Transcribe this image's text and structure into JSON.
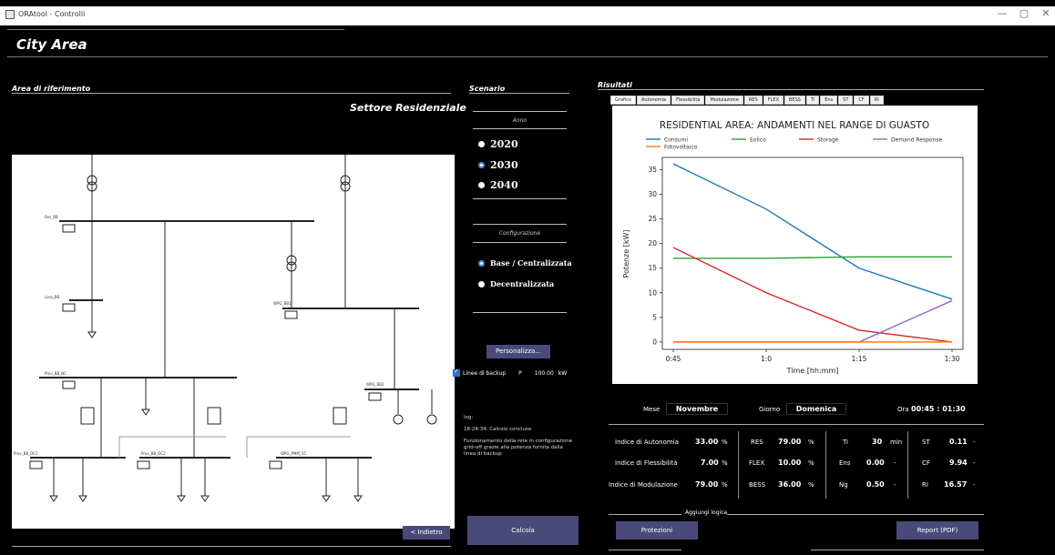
{
  "window": {
    "title": "ORAtool - Controlli",
    "minimize": "—",
    "maximize": "▢",
    "close": "✕"
  },
  "page": {
    "title": "City Area"
  },
  "left": {
    "section": "Area di riferimento",
    "sector": "Settore Residenziale",
    "back_label": "< Indietro"
  },
  "diagram": {
    "nodes": [
      "Res_BB",
      "Loss_BB",
      "WPG_BB1",
      "Prov_BB_NC",
      "WPG_BB2",
      "Prov_BB_DC1",
      "Prov_BB_DC2",
      "WPG_PMM_55"
    ]
  },
  "scenario": {
    "section": "Scenario",
    "anno_caption": "Anno",
    "years": [
      {
        "label": "2020",
        "checked": false
      },
      {
        "label": "2030",
        "checked": true
      },
      {
        "label": "2040",
        "checked": false
      }
    ],
    "config_caption": "Configurazione",
    "configs": [
      {
        "label": "Base / Centralizzata",
        "checked": true
      },
      {
        "label": "Decentralizzata",
        "checked": false
      }
    ],
    "personalizza": "Personalizza...",
    "backup": {
      "label": "Linee di backup",
      "p": "P",
      "value": "100.00",
      "unit": "kW",
      "checked": true
    },
    "log_label": "log:",
    "log_line1": "18:24:34: Calcolo concluso",
    "log_line2": "Funzionamento della rete in configurazione grid-off grazie alla potenza fornita dalla linea di backup",
    "calcola": "Calcola"
  },
  "results": {
    "section": "Risultati",
    "tabs": [
      "Grafico",
      "Autonomia",
      "Flessibilità",
      "Modulazione",
      "RES",
      "FLEX",
      "BESS",
      "Ti",
      "Ens",
      "ST",
      "CF",
      "RI"
    ],
    "active_tab": 0,
    "mese_label": "Mese",
    "mese": "Novembre",
    "giorno_label": "Giorno",
    "giorno": "Domenica",
    "ora_label": "Ora",
    "ora": "00:45 : 01:30",
    "indices": {
      "autonomia_label": "Indice di Autonomia",
      "autonomia": "33.00",
      "autonomia_unit": "%",
      "flessibilita_label": "Indice di Flessibilità",
      "flessibilita": "7.00",
      "flessibilita_unit": "%",
      "modulazione_label": "Indice di Modulazione",
      "modulazione": "79.00",
      "modulazione_unit": "%",
      "res_label": "RES",
      "res": "79.00",
      "res_unit": "%",
      "flex_label": "FLEX",
      "flex": "10.00",
      "flex_unit": "%",
      "bess_label": "BESS",
      "bess": "36.00",
      "bess_unit": "%",
      "ti_label": "Ti",
      "ti": "30",
      "ti_unit": "min",
      "ens_label": "Ens",
      "ens": "0.00",
      "ens_unit": "-",
      "ng_label": "Ng",
      "ng": "0.50",
      "ng_unit": "-",
      "st_label": "ST",
      "st": "0.11",
      "st_unit": "-",
      "cf_label": "CF",
      "cf": "9.94",
      "cf_unit": "-",
      "ri_label": "RI",
      "ri": "16.57",
      "ri_unit": "-"
    },
    "aggiungi_label": "Aggiungi logica",
    "protezioni": "Protezioni",
    "report": "Report (PDF)"
  },
  "chart_data": {
    "type": "line",
    "title": "RESIDENTIAL AREA: ANDAMENTI NEL RANGE DI GUASTO",
    "xlabel": "Time [hh:mm]",
    "ylabel": "Potenze [kW]",
    "categories": [
      "0:45",
      "1:0",
      "1:15",
      "1:30"
    ],
    "ylim": [
      -1.5,
      37.5
    ],
    "yticks": [
      0,
      5,
      10,
      15,
      20,
      25,
      30,
      35
    ],
    "legend_position": "top",
    "series": [
      {
        "name": "Consumi",
        "color": "#1f77b4",
        "values": [
          36.2,
          27,
          15,
          8.7
        ]
      },
      {
        "name": "Eolico",
        "color": "#2ca02c",
        "values": [
          17,
          17,
          17.3,
          17.3
        ]
      },
      {
        "name": "Storage",
        "color": "#d62728",
        "values": [
          19.2,
          10,
          2.4,
          0
        ]
      },
      {
        "name": "Demand Response",
        "color": "#9467bd",
        "values": [
          0,
          0,
          0,
          8.4
        ]
      },
      {
        "name": "Fotovoltaico",
        "color": "#ff7f0e",
        "values": [
          0,
          0,
          0,
          0
        ]
      }
    ]
  }
}
